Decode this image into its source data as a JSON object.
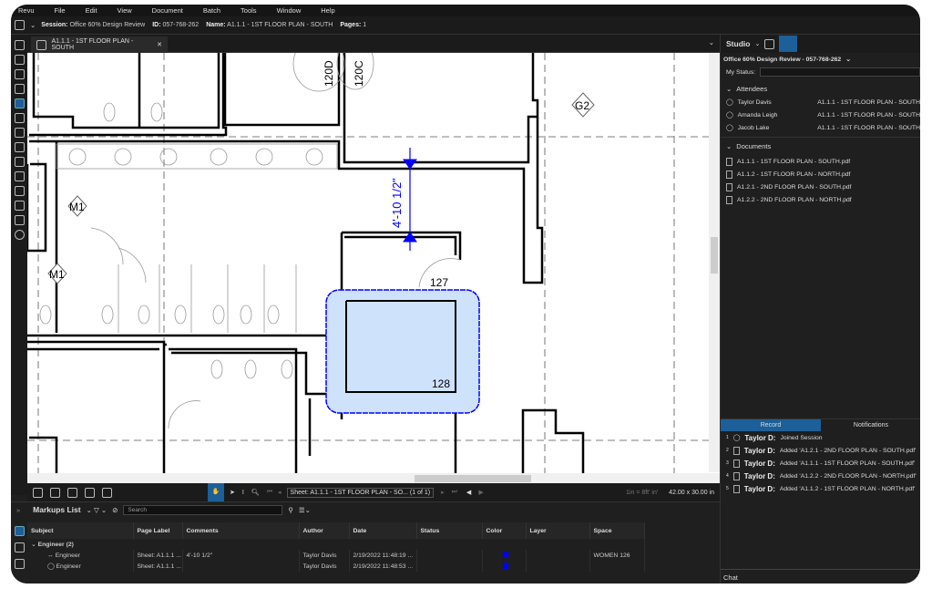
{
  "menu": [
    "Revu",
    "File",
    "Edit",
    "View",
    "Document",
    "Batch",
    "Tools",
    "Window",
    "Help"
  ],
  "session": {
    "session_label": "Session:",
    "session_value": "Office 60% Design Review",
    "id_label": "ID:",
    "id_value": "057-768-262",
    "name_label": "Name:",
    "name_value": "A1.1.1 - 1ST FLOOR PLAN - SOUTH",
    "pages_label": "Pages:",
    "pages_value": "1"
  },
  "tab": {
    "label": "A1.1.1 - 1ST FLOOR PLAN - SOUTH"
  },
  "drawing": {
    "tags": [
      "M1",
      "M1",
      "G2"
    ],
    "doors": [
      "120D",
      "120C"
    ],
    "rooms": [
      "127",
      "128"
    ],
    "dimension": "4'-10 1/2\"",
    "markup_color": "#0000ff",
    "cloud_fill": "#cfe2fb"
  },
  "bottom_toolbar": {
    "sheet": "Sheet: A1.1.1 - 1ST FLOOR PLAN - SO... (1 of 1)",
    "scale": "1in = 8ft' in'",
    "size": "42.00 x 30.00 in"
  },
  "markups": {
    "title": "Markups List",
    "search_placeholder": "Search",
    "columns": [
      "Subject",
      "Page Label",
      "Comments",
      "Author",
      "Date",
      "Status",
      "Color",
      "Layer",
      "Space"
    ],
    "group": "Engineer (2)",
    "rows": [
      {
        "subject": "Engineer",
        "page": "Sheet: A1.1.1 ...",
        "comments": "4'-10 1/2\"",
        "author": "Taylor Davis",
        "date": "2/19/2022 11:48:19 ...",
        "status": "",
        "color": "#0000ff",
        "layer": "",
        "space": "WOMEN 126"
      },
      {
        "subject": "Engineer",
        "page": "Sheet: A1.1.1 ...",
        "comments": "",
        "author": "Taylor Davis",
        "date": "2/19/2022 11:48:53 ...",
        "status": "",
        "color": "#0000ff",
        "layer": "",
        "space": ""
      }
    ]
  },
  "studio": {
    "title": "Studio",
    "session": "Office 60% Design Review  - 057-768-262",
    "status_label": "My Status:",
    "attendees_label": "Attendees",
    "attendees": [
      {
        "name": "Taylor Davis",
        "doc": "A1.1.1 - 1ST FLOOR PLAN - SOUTH"
      },
      {
        "name": "Amanda Leigh",
        "doc": "A1.1.1 - 1ST FLOOR PLAN - SOUTH"
      },
      {
        "name": "Jacob Lake",
        "doc": "A1.1.1 - 1ST FLOOR PLAN - SOUTH"
      }
    ],
    "documents_label": "Documents",
    "documents": [
      "A1.1.1 - 1ST FLOOR PLAN - SOUTH.pdf",
      "A1.1.2 - 1ST FLOOR PLAN - NORTH.pdf",
      "A1.2.1 - 2ND FLOOR PLAN - SOUTH.pdf",
      "A1.2.2 - 2ND FLOOR PLAN - NORTH.pdf"
    ],
    "tabs": [
      "Record",
      "Notifications"
    ],
    "record": [
      {
        "n": "1",
        "user": "Taylor D:",
        "text": "Joined Session"
      },
      {
        "n": "2",
        "user": "Taylor D:",
        "text": "Added 'A1.2.1 - 2ND FLOOR PLAN - SOUTH.pdf'"
      },
      {
        "n": "3",
        "user": "Taylor D:",
        "text": "Added 'A1.1.1 - 1ST FLOOR PLAN - SOUTH.pdf'"
      },
      {
        "n": "4",
        "user": "Taylor D:",
        "text": "Added 'A1.2.2 - 2ND FLOOR PLAN - NORTH.pdf'"
      },
      {
        "n": "5",
        "user": "Taylor D:",
        "text": "Added 'A1.1.2 - 1ST FLOOR PLAN - NORTH.pdf'"
      }
    ],
    "chat_label": "Chat"
  },
  "colors": {
    "accent": "#1c5f99"
  }
}
